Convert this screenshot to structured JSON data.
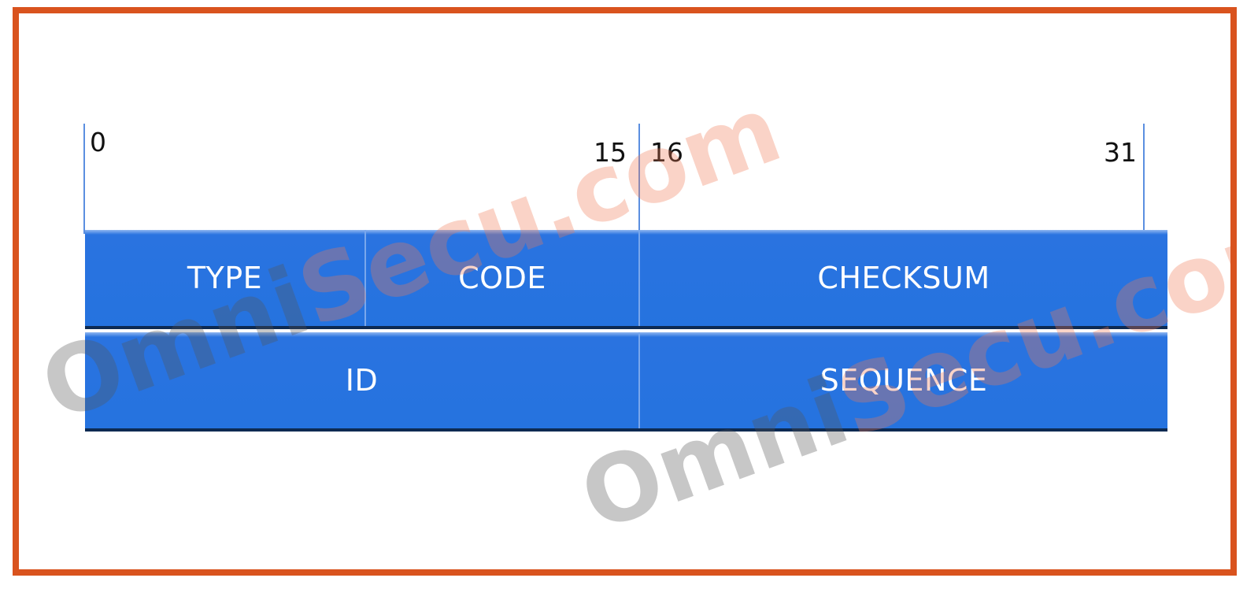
{
  "bit_markers": {
    "start_left": "0",
    "end_left": "15",
    "start_right": "16",
    "end_right": "31"
  },
  "header_row1": {
    "type_label": "TYPE",
    "code_label": "CODE",
    "checksum_label": "CHECKSUM"
  },
  "header_row2": {
    "id_label": "ID",
    "sequence_label": "SEQUENCE"
  },
  "watermark": {
    "part1": "Omni",
    "part2": "Secu.com"
  },
  "colors": {
    "frame_border": "#d9531e",
    "field_fill": "#2573df",
    "bit_line": "#5b8fe0"
  }
}
